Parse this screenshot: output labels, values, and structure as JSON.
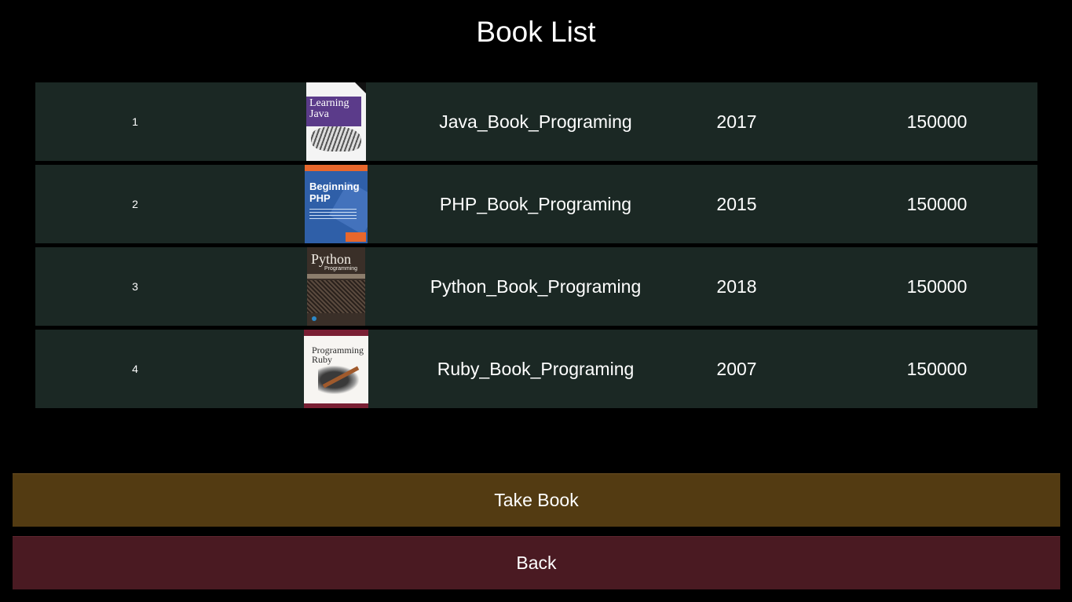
{
  "page": {
    "title": "Book List"
  },
  "books": [
    {
      "index": "1",
      "cover": "learning-java-cover",
      "cover_title": "Learning Java",
      "title": "Java_Book_Programing",
      "year": "2017",
      "price": "150000"
    },
    {
      "index": "2",
      "cover": "beginning-php-cover",
      "cover_title": "Beginning PHP",
      "title": "PHP_Book_Programing",
      "year": "2015",
      "price": "150000"
    },
    {
      "index": "3",
      "cover": "python-programming-cover",
      "cover_title": "Python",
      "cover_subtitle": "Programming",
      "title": "Python_Book_Programing",
      "year": "2018",
      "price": "150000"
    },
    {
      "index": "4",
      "cover": "programming-ruby-cover",
      "cover_title": "Programming Ruby",
      "title": "Ruby_Book_Programing",
      "year": "2007",
      "price": "150000"
    }
  ],
  "actions": {
    "take_label": "Take Book",
    "back_label": "Back"
  },
  "colors": {
    "background": "#000000",
    "row_background": "#1b2824",
    "take_button": "#533b12",
    "back_button": "#4a1a22",
    "text": "#ffffff"
  }
}
